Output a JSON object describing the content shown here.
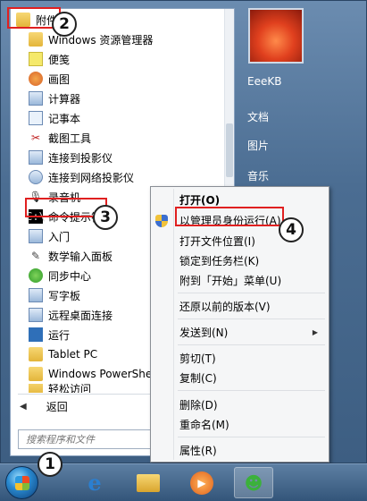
{
  "start_menu": {
    "programs": [
      {
        "label": "附件",
        "icon": "folder-icon"
      },
      {
        "label": "Windows 资源管理器",
        "icon": "explorer-icon"
      },
      {
        "label": "便笺",
        "icon": "sticky-notes-icon"
      },
      {
        "label": "画图",
        "icon": "paint-icon"
      },
      {
        "label": "计算器",
        "icon": "calculator-icon"
      },
      {
        "label": "记事本",
        "icon": "notepad-icon"
      },
      {
        "label": "截图工具",
        "icon": "snipping-tool-icon"
      },
      {
        "label": "连接到投影仪",
        "icon": "projector-icon"
      },
      {
        "label": "连接到网络投影仪",
        "icon": "network-projector-icon"
      },
      {
        "label": "录音机",
        "icon": "microphone-icon"
      },
      {
        "label": "命令提示符",
        "icon": "cmd-icon"
      },
      {
        "label": "入门",
        "icon": "getting-started-icon"
      },
      {
        "label": "数学输入面板",
        "icon": "math-input-icon"
      },
      {
        "label": "同步中心",
        "icon": "sync-icon"
      },
      {
        "label": "写字板",
        "icon": "wordpad-icon"
      },
      {
        "label": "远程桌面连接",
        "icon": "remote-desktop-icon"
      },
      {
        "label": "运行",
        "icon": "run-icon"
      },
      {
        "label": "Tablet PC",
        "icon": "folder-icon"
      },
      {
        "label": "Windows PowerShe",
        "icon": "folder-icon"
      },
      {
        "label": "轻松访问",
        "icon": "folder-icon"
      }
    ],
    "back_label": "返回",
    "search_placeholder": "搜索程序和文件",
    "right_links": [
      "EeeKB",
      "文档",
      "图片",
      "音乐"
    ]
  },
  "context_menu": {
    "items": [
      {
        "label": "打开(O)",
        "bold": true
      },
      {
        "label": "以管理员身份运行(A)"
      },
      {
        "label": "打开文件位置(I)"
      },
      {
        "label": "锁定到任务栏(K)"
      },
      {
        "label": "附到「开始」菜单(U)"
      },
      {
        "label": "还原以前的版本(V)"
      },
      {
        "label": "发送到(N)",
        "submenu": true
      },
      {
        "label": "剪切(T)"
      },
      {
        "label": "复制(C)"
      },
      {
        "label": "删除(D)"
      },
      {
        "label": "重命名(M)"
      },
      {
        "label": "属性(R)"
      }
    ]
  },
  "step_badges": [
    "1",
    "2",
    "3",
    "4"
  ],
  "colors": {
    "highlight": "#e02020"
  }
}
